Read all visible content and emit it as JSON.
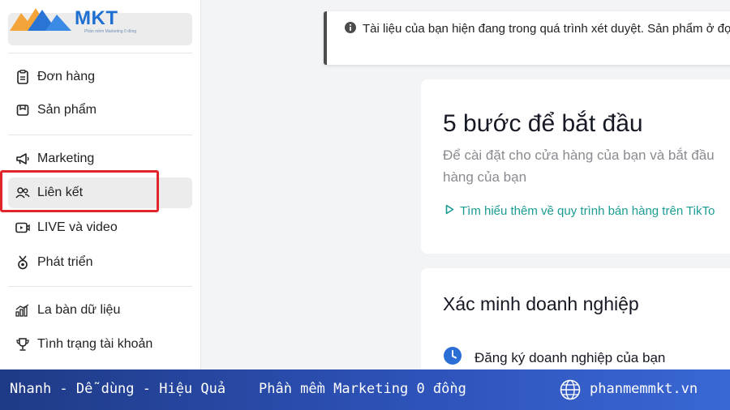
{
  "logo": {
    "brand": "MKT",
    "tagline": "Phần mềm Marketing 0 đồng"
  },
  "sidebar": {
    "items": [
      {
        "label": "Đơn hàng",
        "icon": "clipboard-icon"
      },
      {
        "label": "Sản phẩm",
        "icon": "product-box-icon"
      },
      {
        "label": "Marketing",
        "icon": "megaphone-icon"
      },
      {
        "label": "Liên kết",
        "icon": "affiliate-people-icon"
      },
      {
        "label": "LIVE và video",
        "icon": "live-video-icon"
      },
      {
        "label": "Phát triển",
        "icon": "growth-medal-icon"
      },
      {
        "label": "La bàn dữ liệu",
        "icon": "data-chart-icon"
      },
      {
        "label": "Tình trạng tài khoản",
        "icon": "trophy-icon"
      }
    ],
    "active_index": 3
  },
  "notice": {
    "text": "Tài liệu của bạn hiện đang trong quá trình xét duyệt. Sản phẩm ở đợi!"
  },
  "getting_started": {
    "title": "5 bước để bắt đầu",
    "subtitle": "Để cài đặt cho cửa hàng của bạn và bắt đầu hàng của bạn",
    "link": "Tìm hiểu thêm về quy trình bán hàng trên TikTo"
  },
  "verify": {
    "title": "Xác minh doanh nghiệp",
    "step": "Đăng ký doanh nghiệp của bạn"
  },
  "banner": {
    "slogan": "Nhanh - Dễ dùng - Hiệu Quả",
    "product": "Phần mềm Marketing 0 đồng",
    "website": "phanmemmkt.vn"
  },
  "colors": {
    "highlight": "#e0262a",
    "link": "#1a9c93",
    "step_icon": "#2b6fd6",
    "banner": "#2d52b8"
  }
}
